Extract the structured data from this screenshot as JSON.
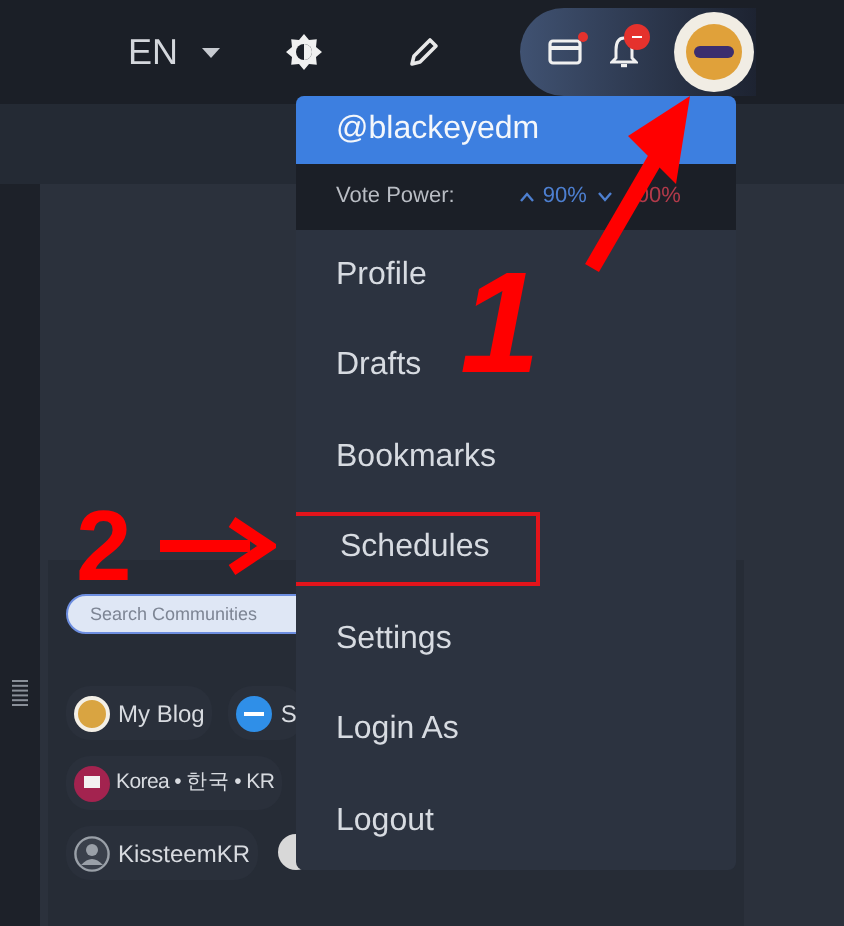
{
  "topbar": {
    "language": "EN"
  },
  "left_panel": {
    "search": {
      "placeholder": "Search Communities"
    },
    "communities": [
      {
        "label": "My Blog"
      },
      {
        "label": "S"
      },
      {
        "label": "Korea • 한국 • KR"
      },
      {
        "label": "KissteemKR"
      }
    ]
  },
  "menu": {
    "username": "@blackeyedm",
    "vote_power": {
      "label": "Vote Power:",
      "up": "90%",
      "down": "00%"
    },
    "items": [
      {
        "label": "Profile",
        "highlighted": false
      },
      {
        "label": "Drafts",
        "highlighted": false
      },
      {
        "label": "Bookmarks",
        "highlighted": false
      },
      {
        "label": "Schedules",
        "highlighted": true
      },
      {
        "label": "Settings",
        "highlighted": false
      },
      {
        "label": "Login As",
        "highlighted": false
      },
      {
        "label": "Logout",
        "highlighted": false
      }
    ]
  },
  "annotations": [
    "1",
    "2"
  ]
}
